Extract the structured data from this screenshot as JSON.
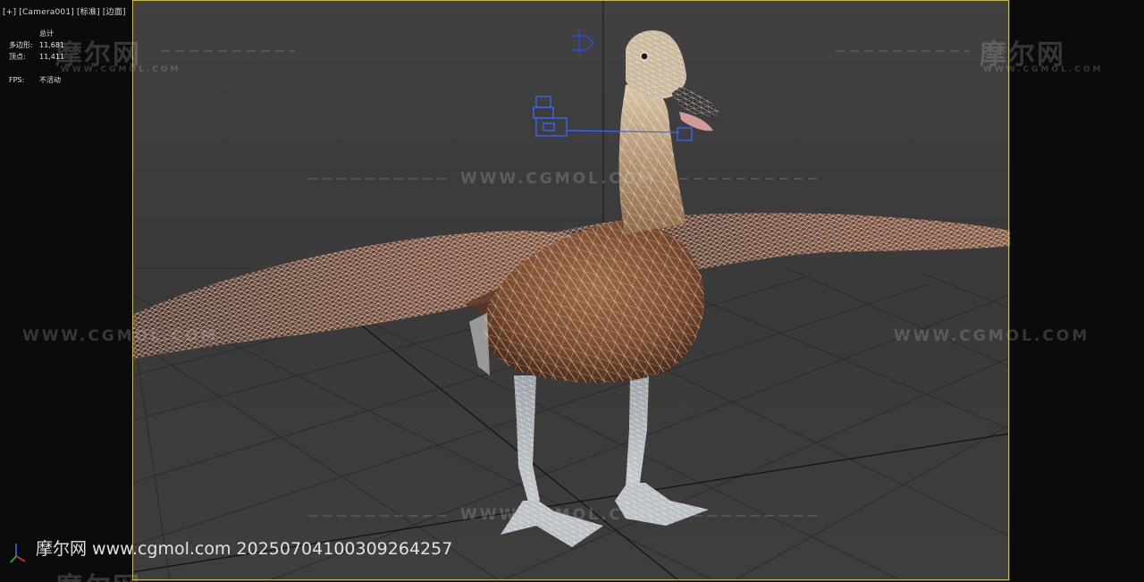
{
  "viewport": {
    "label_parts": [
      "[+]",
      "[Camera001]",
      "[标准]",
      "[边面]"
    ]
  },
  "stats": {
    "total_label": "总计",
    "polygons_label": "多边形:",
    "polygons_value": "11,681",
    "vertices_label": "顶点:",
    "vertices_value": "11,411",
    "fps_label": "FPS:",
    "fps_value": "不活动"
  },
  "watermarks": {
    "logo_text": "摩尔网",
    "logo_sub": "WWW.CGMOL.COM",
    "url_text": "WWW.CGMOL.COM"
  },
  "caption": {
    "text": "摩尔网 www.cgmol.com 20250704100309264257"
  },
  "colors": {
    "safe_frame": "#c9b84a",
    "grid": "#2a2a2a",
    "viewport_bg": "#3c3c3c",
    "wire": "#ffffff",
    "body_brown": "#8a5a3a",
    "gizmo_blue": "#2a50ff"
  },
  "icons": {
    "axis_tripod": "axis-tripod-icon",
    "camera_gizmo": "camera-gizmo-icon",
    "target_gizmo": "target-gizmo-icon"
  }
}
